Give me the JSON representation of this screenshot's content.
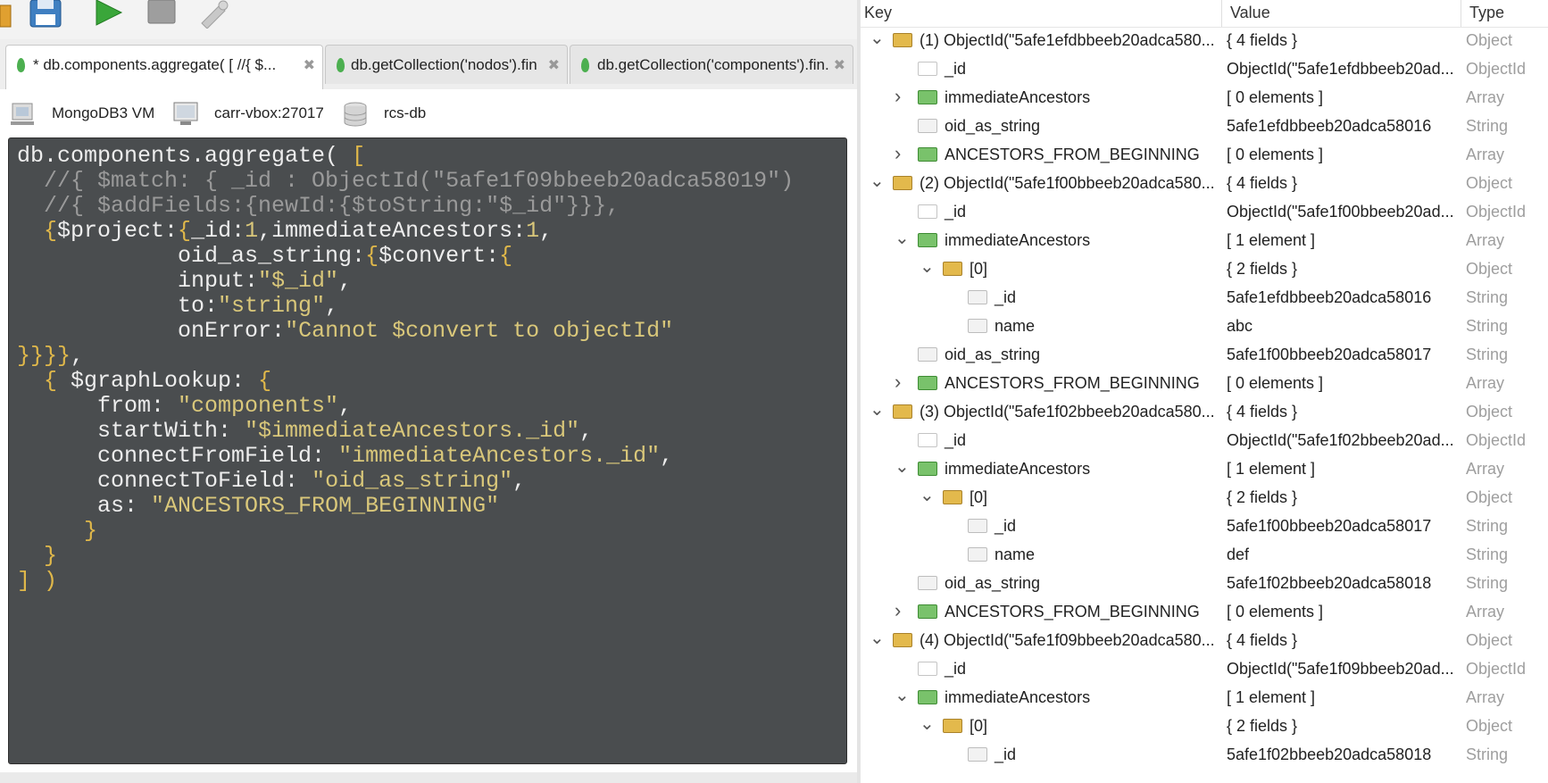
{
  "tabs": [
    {
      "label": "* db.components.aggregate( [   //{ $...",
      "active": true
    },
    {
      "label": "db.getCollection('nodos').fin...",
      "active": false
    },
    {
      "label": "db.getCollection('components').fin...",
      "active": false
    }
  ],
  "connection": {
    "server": "MongoDB3 VM",
    "host": "carr-vbox:27017",
    "database": "rcs-db"
  },
  "editor": {
    "lines": [
      [
        {
          "t": "txt",
          "v": "db.components.aggregate( "
        },
        {
          "t": "brk",
          "v": "["
        }
      ],
      [
        {
          "t": "com",
          "v": "  //{ $match: { _id : ObjectId(\"5afe1f09bbeeb20adca58019\")"
        }
      ],
      [
        {
          "t": "com",
          "v": "  //{ $addFields:{newId:{$toString:\"$_id\"}}},"
        }
      ],
      [
        {
          "t": "brk",
          "v": "  {"
        },
        {
          "t": "txt",
          "v": "$project:"
        },
        {
          "t": "brk",
          "v": "{"
        },
        {
          "t": "txt",
          "v": "_id:"
        },
        {
          "t": "num",
          "v": "1"
        },
        {
          "t": "txt",
          "v": ",immediateAncestors:"
        },
        {
          "t": "num",
          "v": "1"
        },
        {
          "t": "txt",
          "v": ","
        }
      ],
      [
        {
          "t": "txt",
          "v": "            oid_as_string:"
        },
        {
          "t": "brk",
          "v": "{"
        },
        {
          "t": "txt",
          "v": "$convert:"
        },
        {
          "t": "brk",
          "v": "{"
        }
      ],
      [
        {
          "t": "txt",
          "v": "            input:"
        },
        {
          "t": "str",
          "v": "\"$_id\""
        },
        {
          "t": "txt",
          "v": ","
        }
      ],
      [
        {
          "t": "txt",
          "v": "            to:"
        },
        {
          "t": "str",
          "v": "\"string\""
        },
        {
          "t": "txt",
          "v": ","
        }
      ],
      [
        {
          "t": "txt",
          "v": "            onError:"
        },
        {
          "t": "str",
          "v": "\"Cannot $convert to objectId\""
        }
      ],
      [
        {
          "t": "brk",
          "v": "}}}}"
        },
        {
          "t": "txt",
          "v": ","
        }
      ],
      [
        {
          "t": "brk",
          "v": "  { "
        },
        {
          "t": "txt",
          "v": "$graphLookup: "
        },
        {
          "t": "brk",
          "v": "{"
        }
      ],
      [
        {
          "t": "txt",
          "v": "      from: "
        },
        {
          "t": "str",
          "v": "\"components\""
        },
        {
          "t": "txt",
          "v": ","
        }
      ],
      [
        {
          "t": "txt",
          "v": "      startWith: "
        },
        {
          "t": "str",
          "v": "\"$immediateAncestors._id\""
        },
        {
          "t": "txt",
          "v": ","
        }
      ],
      [
        {
          "t": "txt",
          "v": "      connectFromField: "
        },
        {
          "t": "str",
          "v": "\"immediateAncestors._id\""
        },
        {
          "t": "txt",
          "v": ","
        }
      ],
      [
        {
          "t": "txt",
          "v": "      connectToField: "
        },
        {
          "t": "str",
          "v": "\"oid_as_string\""
        },
        {
          "t": "txt",
          "v": ","
        }
      ],
      [
        {
          "t": "txt",
          "v": "      as: "
        },
        {
          "t": "str",
          "v": "\"ANCESTORS_FROM_BEGINNING\""
        }
      ],
      [
        {
          "t": "brk",
          "v": "     }"
        }
      ],
      [
        {
          "t": "brk",
          "v": "  }"
        }
      ],
      [
        {
          "t": "brk",
          "v": "]"
        },
        {
          "t": "txt",
          "v": " "
        },
        {
          "t": "brk",
          "v": ")"
        }
      ]
    ]
  },
  "results": {
    "headers": {
      "key": "Key",
      "value": "Value",
      "type": "Type"
    },
    "rows": [
      {
        "depth": 0,
        "chev": "down",
        "icon": "obj",
        "key": "(1) ObjectId(\"5afe1efdbbeeb20adca580...",
        "value": "{ 4 fields }",
        "type": "Object"
      },
      {
        "depth": 1,
        "chev": "",
        "icon": "oid",
        "key": "_id",
        "value": "ObjectId(\"5afe1efdbbeeb20ad...",
        "type": "ObjectId"
      },
      {
        "depth": 1,
        "chev": "right",
        "icon": "arr",
        "key": "immediateAncestors",
        "value": "[ 0 elements ]",
        "type": "Array"
      },
      {
        "depth": 1,
        "chev": "",
        "icon": "str",
        "key": "oid_as_string",
        "value": "5afe1efdbbeeb20adca58016",
        "type": "String"
      },
      {
        "depth": 1,
        "chev": "right",
        "icon": "arr",
        "key": "ANCESTORS_FROM_BEGINNING",
        "value": "[ 0 elements ]",
        "type": "Array"
      },
      {
        "depth": 0,
        "chev": "down",
        "icon": "obj",
        "key": "(2) ObjectId(\"5afe1f00bbeeb20adca580...",
        "value": "{ 4 fields }",
        "type": "Object"
      },
      {
        "depth": 1,
        "chev": "",
        "icon": "oid",
        "key": "_id",
        "value": "ObjectId(\"5afe1f00bbeeb20ad...",
        "type": "ObjectId"
      },
      {
        "depth": 1,
        "chev": "down",
        "icon": "arr",
        "key": "immediateAncestors",
        "value": "[ 1 element ]",
        "type": "Array"
      },
      {
        "depth": 2,
        "chev": "down",
        "icon": "obj",
        "key": "[0]",
        "value": "{ 2 fields }",
        "type": "Object"
      },
      {
        "depth": 3,
        "chev": "",
        "icon": "str",
        "key": "_id",
        "value": "5afe1efdbbeeb20adca58016",
        "type": "String"
      },
      {
        "depth": 3,
        "chev": "",
        "icon": "str",
        "key": "name",
        "value": "abc",
        "type": "String"
      },
      {
        "depth": 1,
        "chev": "",
        "icon": "str",
        "key": "oid_as_string",
        "value": "5afe1f00bbeeb20adca58017",
        "type": "String"
      },
      {
        "depth": 1,
        "chev": "right",
        "icon": "arr",
        "key": "ANCESTORS_FROM_BEGINNING",
        "value": "[ 0 elements ]",
        "type": "Array"
      },
      {
        "depth": 0,
        "chev": "down",
        "icon": "obj",
        "key": "(3) ObjectId(\"5afe1f02bbeeb20adca580...",
        "value": "{ 4 fields }",
        "type": "Object"
      },
      {
        "depth": 1,
        "chev": "",
        "icon": "oid",
        "key": "_id",
        "value": "ObjectId(\"5afe1f02bbeeb20ad...",
        "type": "ObjectId"
      },
      {
        "depth": 1,
        "chev": "down",
        "icon": "arr",
        "key": "immediateAncestors",
        "value": "[ 1 element ]",
        "type": "Array"
      },
      {
        "depth": 2,
        "chev": "down",
        "icon": "obj",
        "key": "[0]",
        "value": "{ 2 fields }",
        "type": "Object"
      },
      {
        "depth": 3,
        "chev": "",
        "icon": "str",
        "key": "_id",
        "value": "5afe1f00bbeeb20adca58017",
        "type": "String"
      },
      {
        "depth": 3,
        "chev": "",
        "icon": "str",
        "key": "name",
        "value": "def",
        "type": "String"
      },
      {
        "depth": 1,
        "chev": "",
        "icon": "str",
        "key": "oid_as_string",
        "value": "5afe1f02bbeeb20adca58018",
        "type": "String"
      },
      {
        "depth": 1,
        "chev": "right",
        "icon": "arr",
        "key": "ANCESTORS_FROM_BEGINNING",
        "value": "[ 0 elements ]",
        "type": "Array"
      },
      {
        "depth": 0,
        "chev": "down",
        "icon": "obj",
        "key": "(4) ObjectId(\"5afe1f09bbeeb20adca580...",
        "value": "{ 4 fields }",
        "type": "Object"
      },
      {
        "depth": 1,
        "chev": "",
        "icon": "oid",
        "key": "_id",
        "value": "ObjectId(\"5afe1f09bbeeb20ad...",
        "type": "ObjectId"
      },
      {
        "depth": 1,
        "chev": "down",
        "icon": "arr",
        "key": "immediateAncestors",
        "value": "[ 1 element ]",
        "type": "Array"
      },
      {
        "depth": 2,
        "chev": "down",
        "icon": "obj",
        "key": "[0]",
        "value": "{ 2 fields }",
        "type": "Object"
      },
      {
        "depth": 3,
        "chev": "",
        "icon": "str",
        "key": "_id",
        "value": "5afe1f02bbeeb20adca58018",
        "type": "String"
      }
    ]
  }
}
